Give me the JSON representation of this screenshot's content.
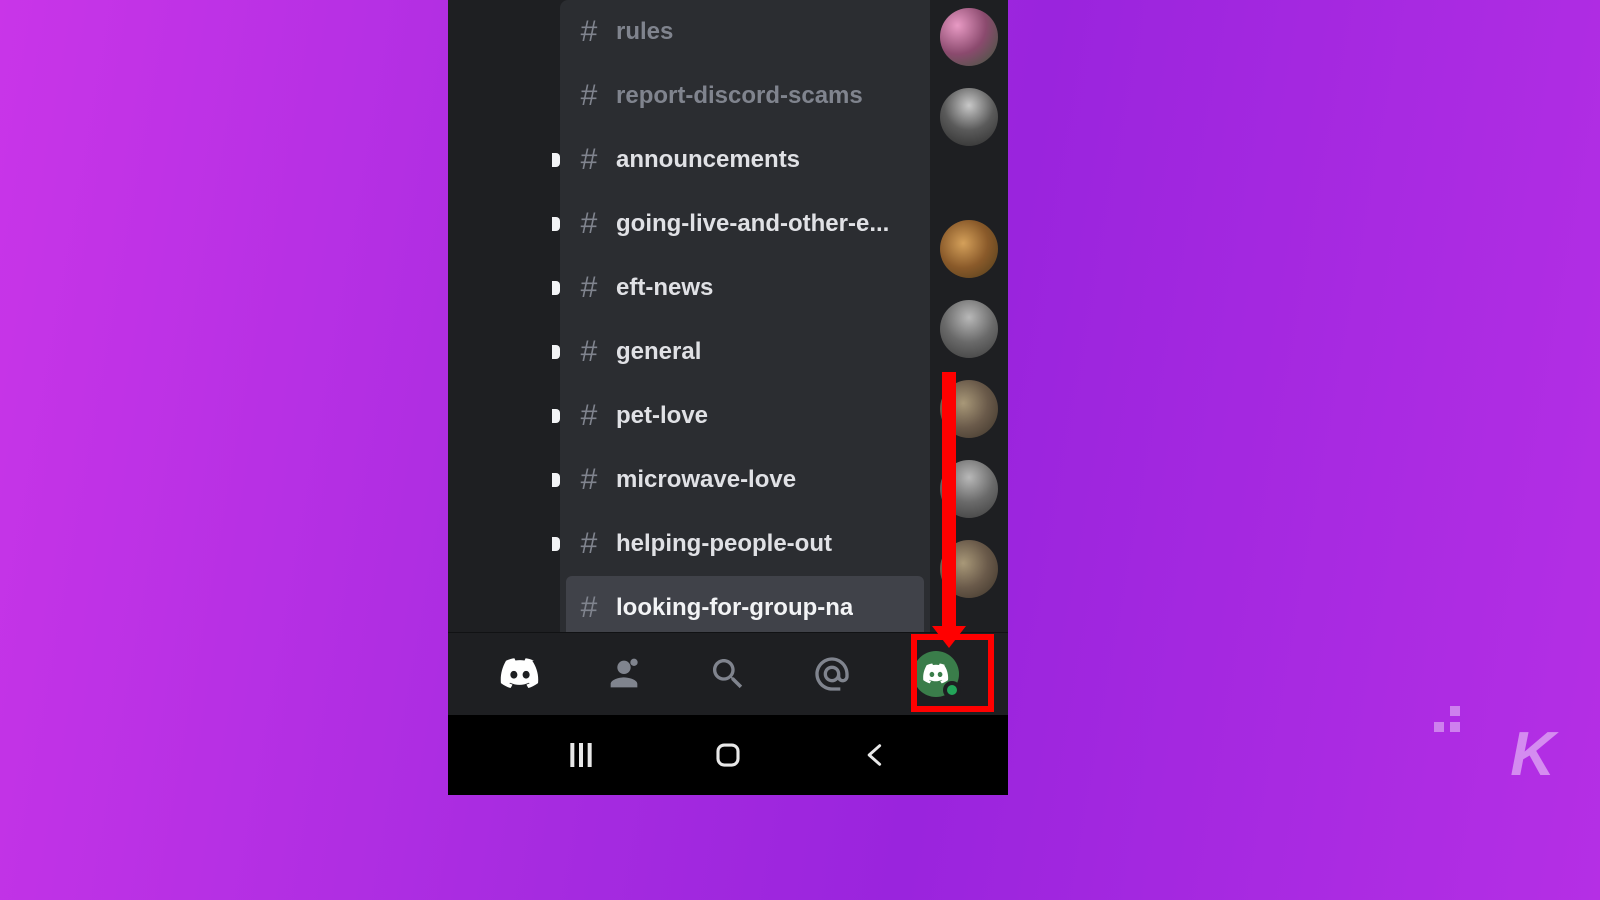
{
  "channels": [
    {
      "name": "rules",
      "muted": true,
      "unread": false
    },
    {
      "name": "report-discord-scams",
      "muted": true,
      "unread": false
    },
    {
      "name": "announcements",
      "muted": false,
      "unread": true
    },
    {
      "name": "going-live-and-other-e...",
      "muted": false,
      "unread": true
    },
    {
      "name": "eft-news",
      "muted": false,
      "unread": true
    },
    {
      "name": "general",
      "muted": false,
      "unread": true
    },
    {
      "name": "pet-love",
      "muted": false,
      "unread": true
    },
    {
      "name": "microwave-love",
      "muted": false,
      "unread": true
    },
    {
      "name": "helping-people-out",
      "muted": false,
      "unread": true
    },
    {
      "name": "looking-for-group-na",
      "muted": false,
      "unread": false,
      "selected": true
    }
  ],
  "bottom_tabs": {
    "home": "discord-logo-icon",
    "friends": "friends-icon",
    "search": "search-icon",
    "mentions": "at-icon",
    "profile": "profile-avatar"
  },
  "android_nav": {
    "recents": "recents-icon",
    "home": "home-icon",
    "back": "back-icon"
  },
  "highlight": {
    "target": "profile-tab",
    "color": "#ff0000"
  },
  "watermark": "K"
}
